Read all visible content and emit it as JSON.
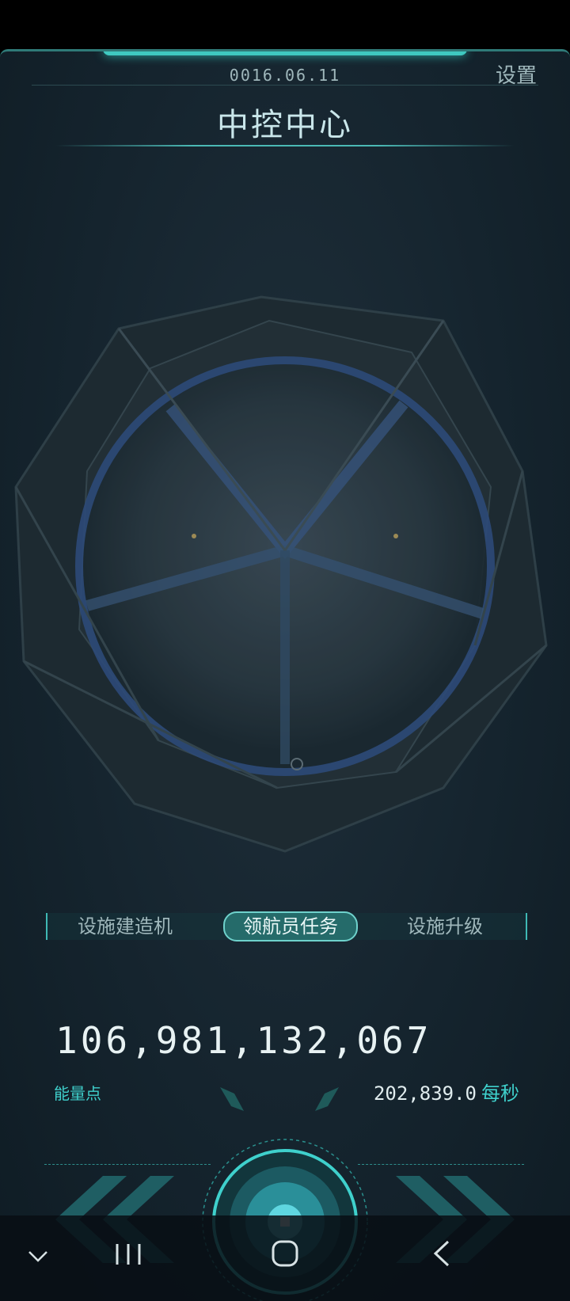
{
  "header": {
    "date": "0016.06.11",
    "settings_label": "设置",
    "title": "中控中心"
  },
  "tabs": [
    {
      "label": "设施建造机",
      "active": false
    },
    {
      "label": "领航员任务",
      "active": true
    },
    {
      "label": "设施升级",
      "active": false
    }
  ],
  "stats": {
    "energy_value": "106,981,132,067",
    "energy_label": "能量点",
    "rate_value": "202,839.0",
    "rate_unit": "每秒"
  },
  "controls": {
    "left_arrows_icon": "double-chevron-left-icon",
    "right_arrows_icon": "double-chevron-right-icon",
    "main_button_icon": "core-button-icon"
  },
  "system_nav": {
    "keyboard_hide_icon": "chevron-down-icon",
    "recents_icon": "recents-icon",
    "home_icon": "home-icon",
    "back_icon": "back-icon"
  },
  "colors": {
    "accent": "#3fd0cc",
    "panel": "#15242e",
    "tab_active": "#256b6a"
  }
}
